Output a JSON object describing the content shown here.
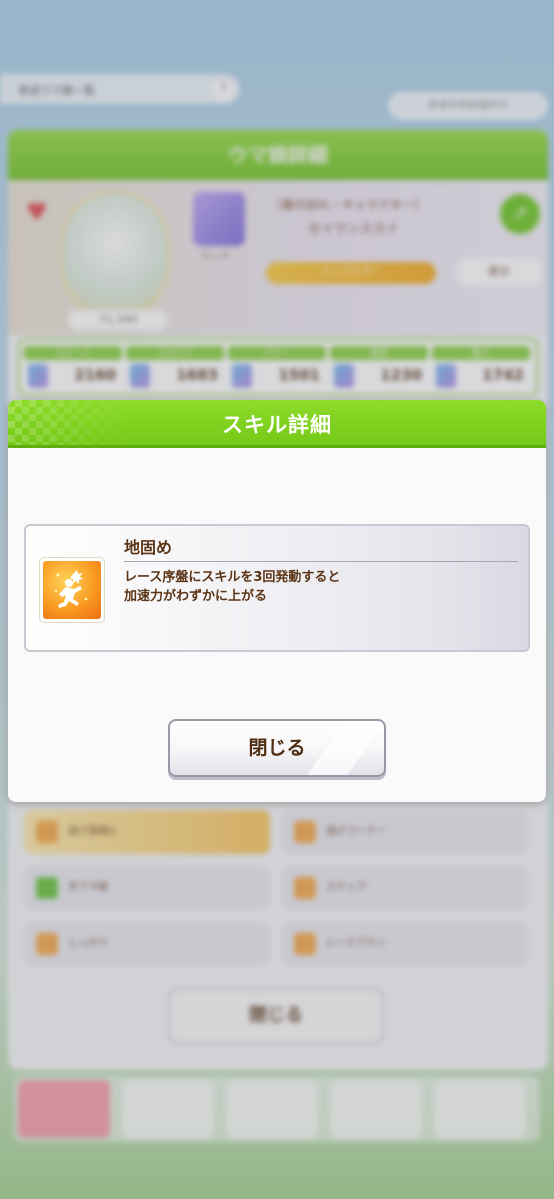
{
  "background": {
    "back_link": "育成ウマ娘一覧",
    "help_icon": "question-icon",
    "top_right_button": "おまかせお出かけ",
    "panel_title": "ウマ娘詳細",
    "character_subtitle": "［春の訪れ・キャラクター］",
    "character_name": "セイウンスカイ",
    "rank_label": "ランク",
    "yellow_bar_label": "トップスター",
    "small_button_label": "表示",
    "fan_count": "71,340",
    "stats": [
      {
        "label": "スピード",
        "value": "2160"
      },
      {
        "label": "スタミナ",
        "value": "1683"
      },
      {
        "label": "パワー",
        "value": "1501"
      },
      {
        "label": "根性",
        "value": "1230"
      },
      {
        "label": "賢さ",
        "value": "1742"
      }
    ],
    "skill_list": [
      {
        "label": "逃げ直線◎"
      },
      {
        "label": "逃げコーナー"
      },
      {
        "label": "冬ウマ娘"
      },
      {
        "label": "ステップ"
      },
      {
        "label": "しっかり"
      },
      {
        "label": "レースプラン"
      }
    ],
    "close_button": "閉じる",
    "accent_green": "#6cc21c"
  },
  "modal": {
    "title": "スキル詳細",
    "skill": {
      "name": "地固め",
      "icon": "running-figure-icon",
      "description_line1": "レース序盤にスキルを3回発動すると",
      "description_line2": "加速力がわずかに上がる"
    },
    "close_button": "閉じる",
    "colors": {
      "header": "#7ccd1c",
      "text_brown": "#5b3416",
      "icon_orange": "#f99b22"
    }
  }
}
